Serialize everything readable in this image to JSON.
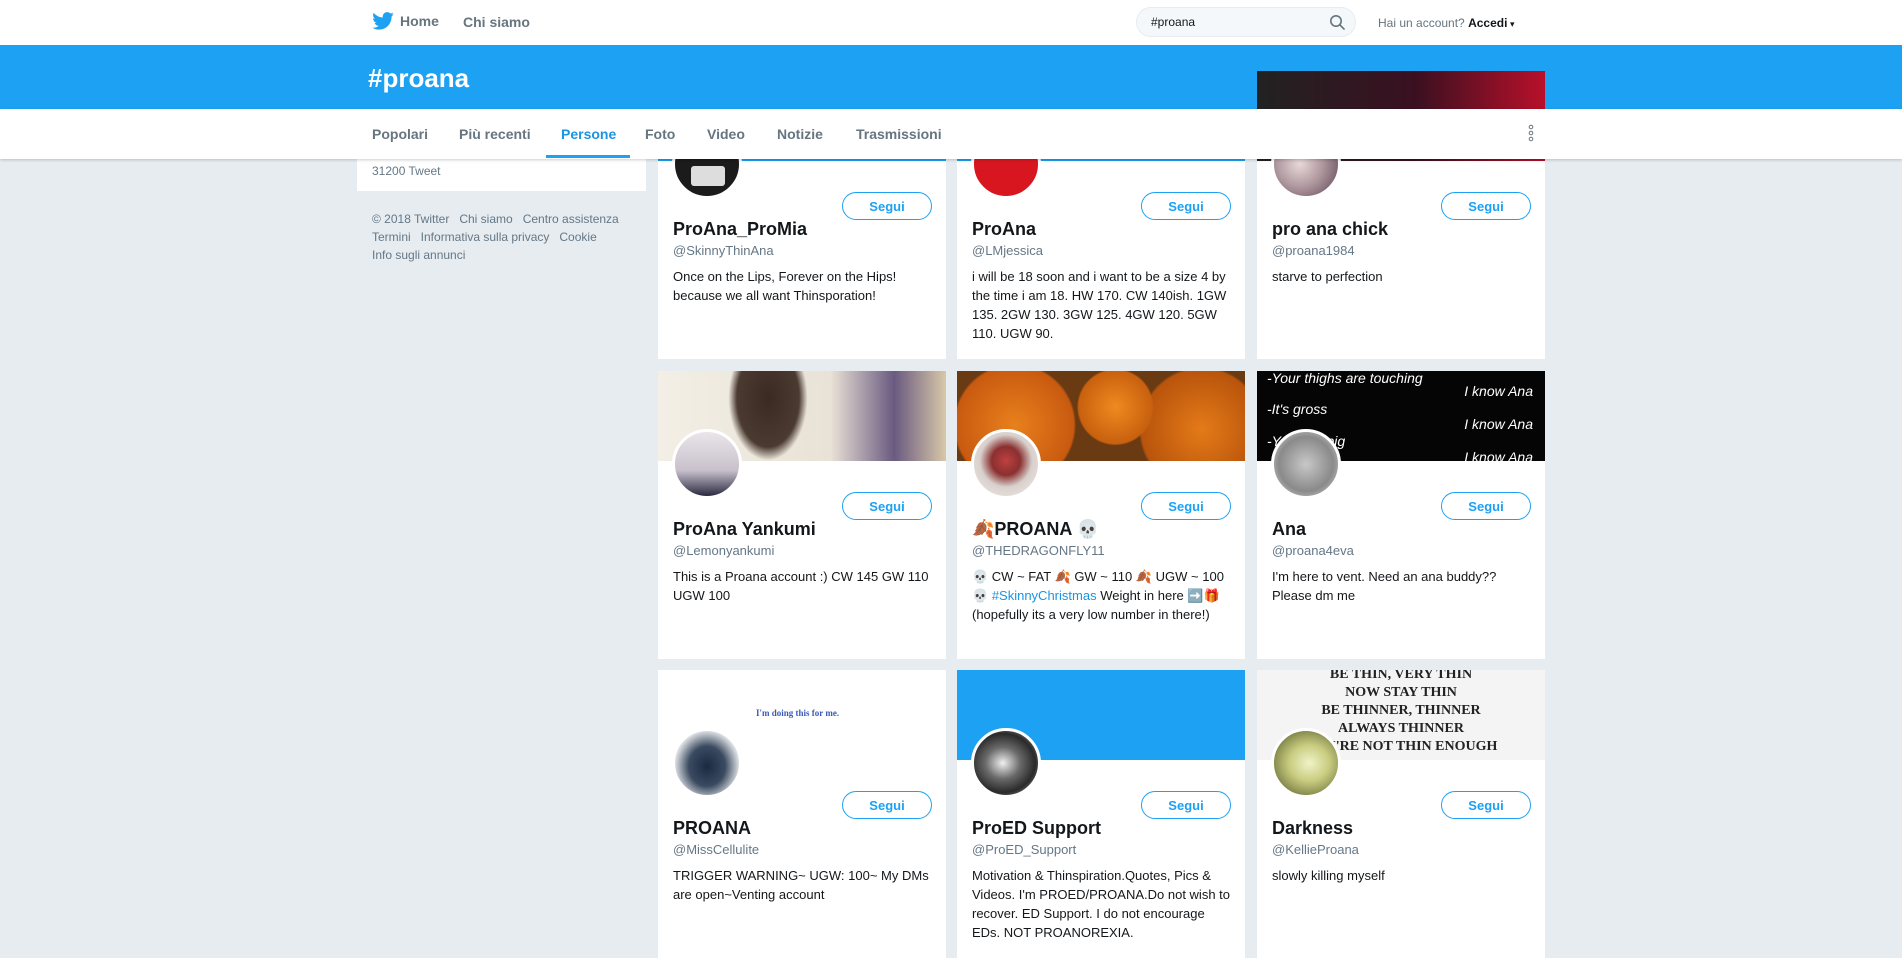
{
  "nav": {
    "home_label": "Home",
    "about_label": "Chi siamo",
    "search_value": "#proana",
    "account_question": "Hai un account?",
    "login_label": "Accedi"
  },
  "header": {
    "title": "#proana"
  },
  "tabs": [
    {
      "label": "Popolari"
    },
    {
      "label": "Più recenti"
    },
    {
      "label": "Persone"
    },
    {
      "label": "Foto"
    },
    {
      "label": "Video"
    },
    {
      "label": "Notizie"
    },
    {
      "label": "Trasmissioni"
    }
  ],
  "sidebar": {
    "tweet_count": "31200 Tweet"
  },
  "footer": {
    "links": [
      "© 2018 Twitter",
      "Chi siamo",
      "Centro assistenza",
      "Termini",
      "Informativa sulla privacy",
      "Cookie",
      "Info sugli annunci"
    ]
  },
  "follow_label": "Segui",
  "users": [
    {
      "name": "ProAna_ProMia",
      "handle": "@SkinnyThinAna",
      "bio": "Once on the Lips, Forever on the Hips! because we all want Thinsporation!"
    },
    {
      "name": "ProAna",
      "handle": "@LMjessica",
      "bio": "i will be 18 soon and i want to be a size 4 by the time i am 18. HW 170. CW 140ish. 1GW 135. 2GW 130. 3GW 125. 4GW 120. 5GW 110. UGW 90."
    },
    {
      "name": "pro ana chick",
      "handle": "@proana1984",
      "bio": "starve to perfection"
    },
    {
      "name": "ProAna Yankumi",
      "handle": "@Lemonyankumi",
      "bio": "This is a Proana account :) CW 145 GW 110 UGW 100"
    },
    {
      "name": "🍂PROANA 💀",
      "handle": "@THEDRAGONFLY11",
      "bio_pre": "💀 CW ~ FAT 🍂 GW ~ 110 🍂 UGW ~ 100 💀 ",
      "bio_tag": "#SkinnyChristmas",
      "bio_post": " Weight in here ➡️🎁 (hopefully its a very low number in there!)"
    },
    {
      "name": "Ana",
      "handle": "@proana4eva",
      "bio": "I'm here to vent. Need an ana buddy?? Please dm me"
    },
    {
      "name": "PROANA",
      "handle": "@MissCellulite",
      "bio": "TRIGGER WARNING~ UGW: 100~ My DMs are open~Venting account"
    },
    {
      "name": "ProED Support",
      "handle": "@ProED_Support",
      "bio": "Motivation & Thinspiration.Quotes, Pics & Videos. I'm PROED/PROANA.Do not wish to recover. ED Support. I do not encourage EDs. NOT PROANOREXIA."
    },
    {
      "name": "Darkness",
      "handle": "@KellieProana",
      "bio": "slowly killing myself"
    }
  ],
  "banner_texts": {
    "card6": [
      "-Your thighs are touching",
      "I know Ana",
      "-It's gross",
      "I know Ana",
      "-You're a pig",
      "I know Ana"
    ],
    "card7": "I'm doing this for me.",
    "card9": [
      "BE THIN, VERY THIN",
      "NOW STAY THIN",
      "BE THINNER, THINNER",
      "ALWAYS THINNER",
      "YOU'RE NOT THIN ENOUGH"
    ]
  },
  "colors": {
    "accent": "#1da1f2",
    "background": "#e6ecf0"
  }
}
